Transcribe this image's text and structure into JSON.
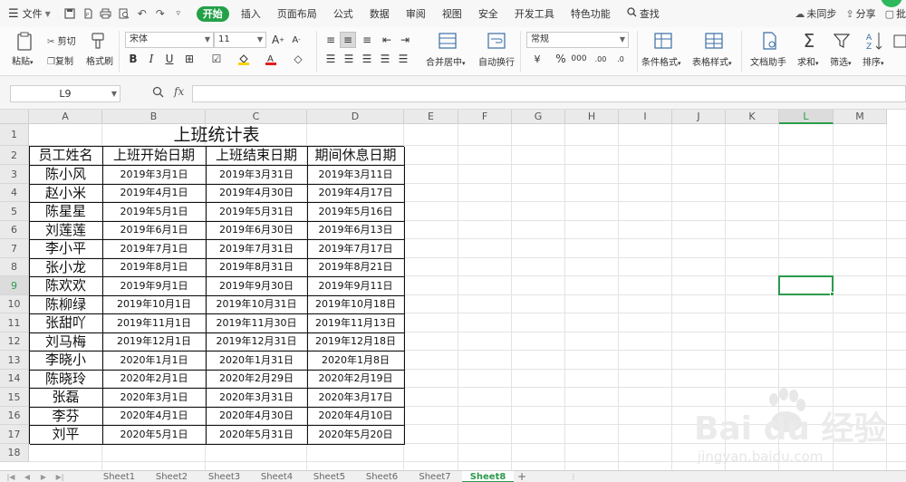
{
  "menubar": {
    "file_label": "文件",
    "tabs": [
      "开始",
      "插入",
      "页面布局",
      "公式",
      "数据",
      "审阅",
      "视图",
      "安全",
      "开发工具",
      "特色功能"
    ],
    "active_tab": "开始",
    "search_label": "查找",
    "sync_label": "未同步",
    "share_label": "分享",
    "comment_label": "批"
  },
  "ribbon": {
    "paste_label": "粘贴",
    "cut_label": "剪切",
    "copy_label": "复制",
    "format_painter_label": "格式刷",
    "font_name": "宋体",
    "font_size": "11",
    "merge_label": "合并居中",
    "wrap_label": "自动换行",
    "number_format": "常规",
    "conditional_label": "条件格式",
    "table_style_label": "表格样式",
    "doc_helper_label": "文档助手",
    "sum_label": "求和",
    "filter_label": "筛选",
    "sort_label": "排序"
  },
  "formula": {
    "namebox": "L9",
    "fx": "fx",
    "value": ""
  },
  "grid": {
    "columns": [
      "A",
      "B",
      "C",
      "D",
      "E",
      "F",
      "G",
      "H",
      "I",
      "J",
      "K",
      "L",
      "M"
    ],
    "active_column": "L",
    "rows": [
      "1",
      "2",
      "3",
      "4",
      "5",
      "6",
      "7",
      "8",
      "9",
      "10",
      "11",
      "12",
      "13",
      "14",
      "15",
      "16",
      "17",
      "18"
    ],
    "active_row": "9"
  },
  "sheet": {
    "title": "上班统计表",
    "headers": [
      "员工姓名",
      "上班开始日期",
      "上班结束日期",
      "期间休息日期"
    ],
    "rows": [
      [
        "陈小风",
        "2019年3月1日",
        "2019年3月31日",
        "2019年3月11日"
      ],
      [
        "赵小米",
        "2019年4月1日",
        "2019年4月30日",
        "2019年4月17日"
      ],
      [
        "陈星星",
        "2019年5月1日",
        "2019年5月31日",
        "2019年5月16日"
      ],
      [
        "刘莲莲",
        "2019年6月1日",
        "2019年6月30日",
        "2019年6月13日"
      ],
      [
        "李小平",
        "2019年7月1日",
        "2019年7月31日",
        "2019年7月17日"
      ],
      [
        "张小龙",
        "2019年8月1日",
        "2019年8月31日",
        "2019年8月21日"
      ],
      [
        "陈欢欢",
        "2019年9月1日",
        "2019年9月30日",
        "2019年9月11日"
      ],
      [
        "陈柳绿",
        "2019年10月1日",
        "2019年10月31日",
        "2019年10月18日"
      ],
      [
        "张甜吖",
        "2019年11月1日",
        "2019年11月30日",
        "2019年11月13日"
      ],
      [
        "刘马梅",
        "2019年12月1日",
        "2019年12月31日",
        "2019年12月18日"
      ],
      [
        "李晓小",
        "2020年1月1日",
        "2020年1月31日",
        "2020年1月8日"
      ],
      [
        "陈晓玲",
        "2020年2月1日",
        "2020年2月29日",
        "2020年2月19日"
      ],
      [
        "张磊",
        "2020年3月1日",
        "2020年3月31日",
        "2020年3月17日"
      ],
      [
        "李芬",
        "2020年4月1日",
        "2020年4月30日",
        "2020年4月10日"
      ],
      [
        "刘平",
        "2020年5月1日",
        "2020年5月31日",
        "2020年5月20日"
      ]
    ]
  },
  "sheet_tabs": [
    "Sheet1",
    "Sheet2",
    "Sheet3",
    "Sheet4",
    "Sheet5",
    "Sheet6",
    "Sheet7",
    "Sheet8"
  ],
  "active_sheet": "Sheet8",
  "watermark": {
    "brand": "Bai du 经验",
    "url": "jingyan.baidu.com"
  },
  "colors": {
    "accent": "#2b9a4c",
    "tab_active_bg": "#24a148"
  }
}
